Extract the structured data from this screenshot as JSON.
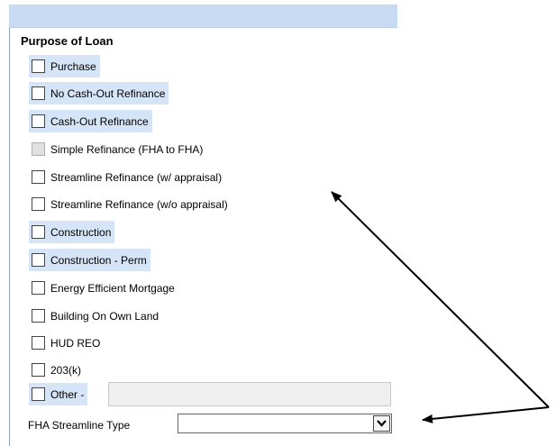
{
  "section": {
    "title": "Purpose of Loan"
  },
  "options": [
    {
      "label": "Purchase",
      "highlighted": true,
      "disabled": false,
      "checked": false
    },
    {
      "label": "No Cash-Out Refinance",
      "highlighted": true,
      "disabled": false,
      "checked": false
    },
    {
      "label": "Cash-Out Refinance",
      "highlighted": true,
      "disabled": false,
      "checked": false
    },
    {
      "label": "Simple Refinance (FHA to FHA)",
      "highlighted": false,
      "disabled": true,
      "checked": false
    },
    {
      "label": "Streamline Refinance (w/ appraisal)",
      "highlighted": false,
      "disabled": false,
      "checked": false
    },
    {
      "label": "Streamline Refinance (w/o appraisal)",
      "highlighted": false,
      "disabled": false,
      "checked": false
    },
    {
      "label": "Construction",
      "highlighted": true,
      "disabled": false,
      "checked": false
    },
    {
      "label": "Construction - Perm",
      "highlighted": true,
      "disabled": false,
      "checked": false
    },
    {
      "label": "Energy Efficient Mortgage",
      "highlighted": false,
      "disabled": false,
      "checked": false
    },
    {
      "label": "Building On Own Land",
      "highlighted": false,
      "disabled": false,
      "checked": false
    },
    {
      "label": "HUD REO",
      "highlighted": false,
      "disabled": false,
      "checked": false
    },
    {
      "label": "203(k)",
      "highlighted": false,
      "disabled": false,
      "checked": false
    },
    {
      "label": "Other -",
      "highlighted": true,
      "disabled": false,
      "checked": false
    }
  ],
  "other_input": {
    "value": ""
  },
  "streamline": {
    "label": "FHA Streamline Type",
    "selected": ""
  },
  "colors": {
    "highlight": "#d6e4f7",
    "topbar": "#c9dbf3",
    "disabled_checkbox": "#e1e1e1"
  },
  "icons": {
    "dropdown": "chevron-down-icon"
  }
}
